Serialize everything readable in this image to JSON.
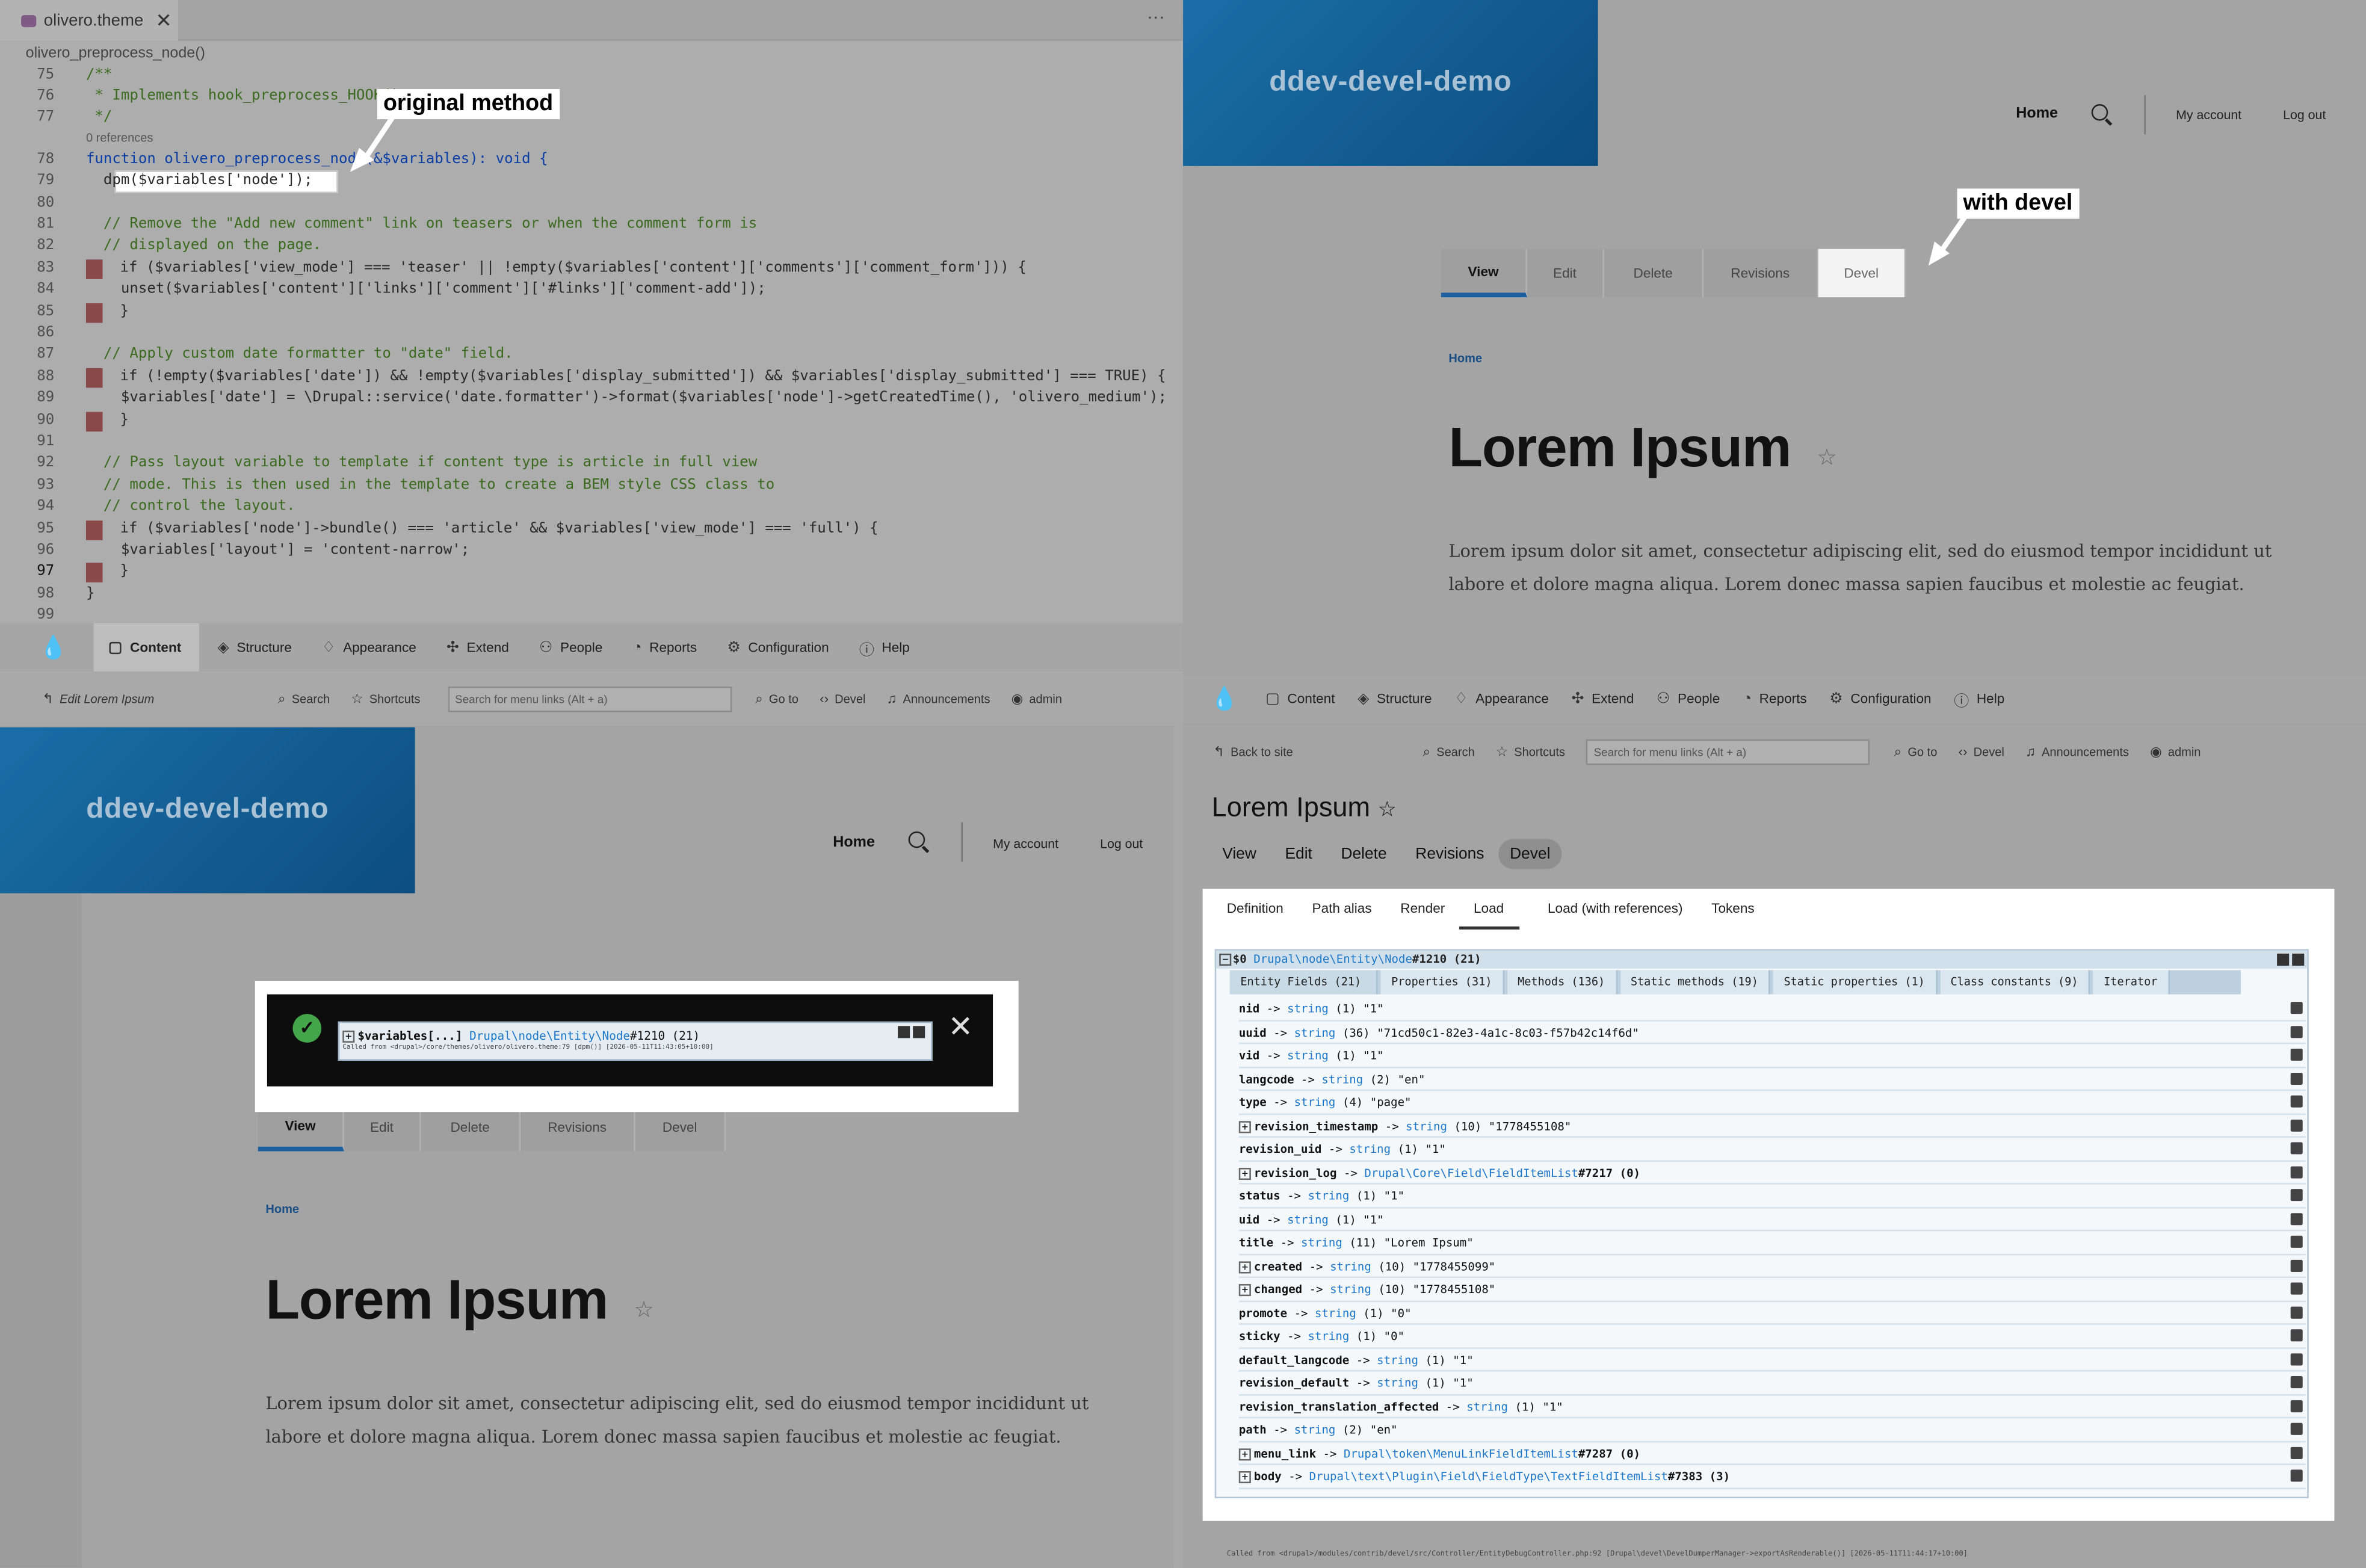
{
  "editor": {
    "tab_label": "olivero.theme",
    "tab_close": "✕",
    "more": "···",
    "breadcrumb": "olivero_preprocess_node()",
    "references": "0 references",
    "lines": [
      {
        "n": "75",
        "t": "/**"
      },
      {
        "n": "76",
        "t": " * Implements hook_preprocess_HOOK()"
      },
      {
        "n": "77",
        "t": " */"
      },
      {
        "n": "78",
        "t": "function olivero_preprocess_node(&$variables): void {"
      },
      {
        "n": "79",
        "t": "  dpm($variables['node']);"
      },
      {
        "n": "80",
        "t": ""
      },
      {
        "n": "81",
        "t": "  // Remove the \"Add new comment\" link on teasers or when the comment form is"
      },
      {
        "n": "82",
        "t": "  // displayed on the page."
      },
      {
        "n": "83",
        "t": "  if ($variables['view_mode'] === 'teaser' || !empty($variables['content']['comments']['comment_form'])) {"
      },
      {
        "n": "84",
        "t": "    unset($variables['content']['links']['comment']['#links']['comment-add']);"
      },
      {
        "n": "85",
        "t": "  }"
      },
      {
        "n": "86",
        "t": ""
      },
      {
        "n": "87",
        "t": "  // Apply custom date formatter to \"date\" field."
      },
      {
        "n": "88",
        "t": "  if (!empty($variables['date']) && !empty($variables['display_submitted']) && $variables['display_submitted'] === TRUE) {"
      },
      {
        "n": "89",
        "t": "    $variables['date'] = \\Drupal::service('date.formatter')->format($variables['node']->getCreatedTime(), 'olivero_medium');"
      },
      {
        "n": "90",
        "t": "  }"
      },
      {
        "n": "91",
        "t": ""
      },
      {
        "n": "92",
        "t": "  // Pass layout variable to template if content type is article in full view"
      },
      {
        "n": "93",
        "t": "  // mode. This is then used in the template to create a BEM style CSS class to"
      },
      {
        "n": "94",
        "t": "  // control the layout."
      },
      {
        "n": "95",
        "t": "  if ($variables['node']->bundle() === 'article' && $variables['view_mode'] === 'full') {"
      },
      {
        "n": "96",
        "t": "    $variables['layout'] = 'content-narrow';"
      },
      {
        "n": "97",
        "t": "  }"
      },
      {
        "n": "98",
        "t": "}"
      },
      {
        "n": "99",
        "t": ""
      }
    ]
  },
  "callouts": {
    "original": "original method",
    "devel": "with devel"
  },
  "site": {
    "name": "ddev-devel-demo",
    "nav_home": "Home",
    "nav_account": "My account",
    "nav_logout": "Log out",
    "tabs": [
      "View",
      "Edit",
      "Delete",
      "Revisions",
      "Devel"
    ],
    "breadcrumb": "Home",
    "title": "Lorem Ipsum",
    "star": "☆",
    "body_line1": "Lorem ipsum dolor sit amet, consectetur adipiscing elit, sed do eiusmod tempor incididunt ut",
    "body_line2": "labore et dolore magna aliqua. Lorem donec massa sapien faucibus et molestie ac feugiat."
  },
  "toolbar": {
    "items": [
      "Content",
      "Structure",
      "Appearance",
      "Extend",
      "People",
      "Reports",
      "Configuration",
      "Help"
    ]
  },
  "subbar_left": {
    "back": "Edit Lorem Ipsum",
    "search": "Search",
    "shortcuts": "Shortcuts",
    "search_placeholder": "Search for menu links (Alt + a)",
    "goto": "Go to",
    "devel": "Devel",
    "announcements": "Announcements",
    "admin": "admin"
  },
  "subbar_right": {
    "back": "Back to site"
  },
  "message": {
    "check": "✓",
    "close": "✕",
    "header_var": "$variables[...]",
    "header_class": "Drupal\\node\\Entity\\Node",
    "header_id": "#1210 (21)",
    "called_from": "Called from <drupal>/core/themes/olivero/olivero.theme:79 [dpm()] [2026-05-11T11:43:05+10:00]"
  },
  "admin": {
    "title": "Lorem Ipsum",
    "tabs": [
      "View",
      "Edit",
      "Delete",
      "Revisions",
      "Devel"
    ],
    "devel_tabs": [
      "Definition",
      "Path alias",
      "Render",
      "Load",
      "Load (with references)",
      "Tokens"
    ],
    "devel_active": "Load"
  },
  "dump": {
    "header_var": "$0",
    "header_class": "Drupal\\node\\Entity\\Node",
    "header_id": "#1210 (21)",
    "tabs": [
      "Entity Fields (21)",
      "Properties (31)",
      "Methods (136)",
      "Static methods (19)",
      "Static properties (1)",
      "Class constants (9)",
      "Iterator"
    ],
    "rows": [
      {
        "k": "nid",
        "ty": "string",
        "v": "(1) \"1\"",
        "exp": false
      },
      {
        "k": "uuid",
        "ty": "string",
        "v": "(36) \"71cd50c1-82e3-4a1c-8c03-f57b42c14f6d\"",
        "exp": false
      },
      {
        "k": "vid",
        "ty": "string",
        "v": "(1) \"1\"",
        "exp": false
      },
      {
        "k": "langcode",
        "ty": "string",
        "v": "(2) \"en\"",
        "exp": false
      },
      {
        "k": "type",
        "ty": "string",
        "v": "(4) \"page\"",
        "exp": false
      },
      {
        "k": "revision_timestamp",
        "ty": "string",
        "v": "(10) \"1778455108\"",
        "exp": true
      },
      {
        "k": "revision_uid",
        "ty": "string",
        "v": "(1) \"1\"",
        "exp": false
      },
      {
        "k": "revision_log",
        "ty": "Drupal\\Core\\Field\\FieldItemList",
        "v": "#7217 (0)",
        "exp": true
      },
      {
        "k": "status",
        "ty": "string",
        "v": "(1) \"1\"",
        "exp": false
      },
      {
        "k": "uid",
        "ty": "string",
        "v": "(1) \"1\"",
        "exp": false
      },
      {
        "k": "title",
        "ty": "string",
        "v": "(11) \"Lorem Ipsum\"",
        "exp": false
      },
      {
        "k": "created",
        "ty": "string",
        "v": "(10) \"1778455099\"",
        "exp": true
      },
      {
        "k": "changed",
        "ty": "string",
        "v": "(10) \"1778455108\"",
        "exp": true
      },
      {
        "k": "promote",
        "ty": "string",
        "v": "(1) \"0\"",
        "exp": false
      },
      {
        "k": "sticky",
        "ty": "string",
        "v": "(1) \"0\"",
        "exp": false
      },
      {
        "k": "default_langcode",
        "ty": "string",
        "v": "(1) \"1\"",
        "exp": false
      },
      {
        "k": "revision_default",
        "ty": "string",
        "v": "(1) \"1\"",
        "exp": false
      },
      {
        "k": "revision_translation_affected",
        "ty": "string",
        "v": "(1) \"1\"",
        "exp": false
      },
      {
        "k": "path",
        "ty": "string",
        "v": "(2) \"en\"",
        "exp": false
      },
      {
        "k": "menu_link",
        "ty": "Drupal\\token\\MenuLinkFieldItemList",
        "v": "#7287 (0)",
        "exp": true
      },
      {
        "k": "body",
        "ty": "Drupal\\text\\Plugin\\Field\\FieldType\\TextFieldItemList",
        "v": "#7383 (3)",
        "exp": true
      }
    ],
    "called_from": "Called from <drupal>/modules/contrib/devel/src/Controller/EntityDebugController.php:92 [Drupal\\devel\\DevelDumperManager->exportAsRenderable()] [2026-05-11T11:44:17+10:00]"
  }
}
